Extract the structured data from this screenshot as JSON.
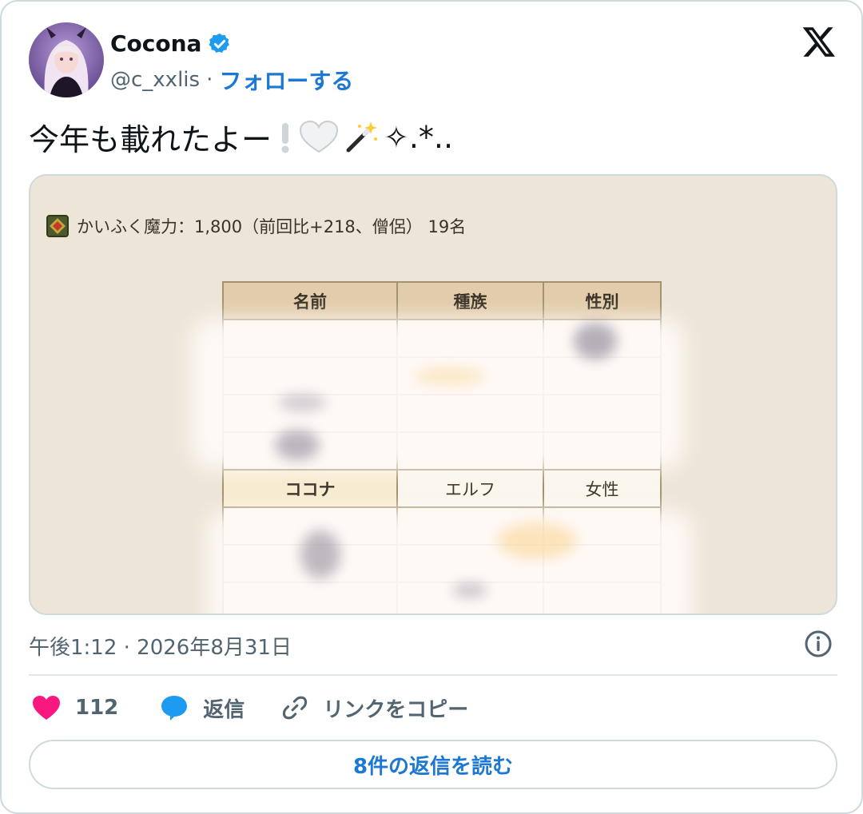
{
  "author": {
    "display_name": "Cocona",
    "handle": "@c_xxlis",
    "separator": "·",
    "follow_label": "フォローする"
  },
  "tweet": {
    "text": "今年も載れたよー",
    "trailing_text": "✧.*.."
  },
  "media": {
    "caption": "かいふく魔力：1,800（前回比+218、僧侶） 19名",
    "table": {
      "headers": [
        "名前",
        "種族",
        "性別"
      ],
      "highlight_row": [
        "ココナ",
        "エルフ",
        "女性"
      ]
    }
  },
  "timestamp": "午後1:12 · 2026年8月31日",
  "actions": {
    "like_count": "112",
    "reply_label": "返信",
    "copy_link_label": "リンクをコピー"
  },
  "read_replies_label": "8件の返信を読む",
  "colors": {
    "accent": "#1d78d4",
    "like": "#f91880",
    "reply": "#1d9bf0",
    "verified": "#1d9bf0"
  }
}
